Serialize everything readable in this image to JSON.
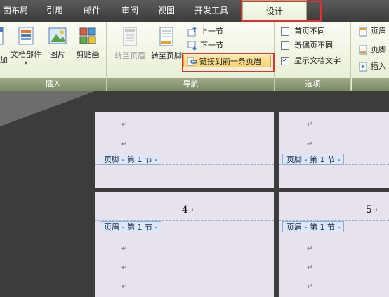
{
  "tabs": [
    {
      "label": "面布局"
    },
    {
      "label": "引用"
    },
    {
      "label": "邮件"
    },
    {
      "label": "审阅"
    },
    {
      "label": "视图"
    },
    {
      "label": "开发工具"
    },
    {
      "label": "设计"
    }
  ],
  "ribbon": {
    "insert_group": {
      "label": "插入",
      "buttons": [
        {
          "label": "加"
        },
        {
          "label": "文档部件"
        },
        {
          "label": "图片"
        },
        {
          "label": "剪贴画"
        }
      ]
    },
    "nav_group": {
      "label": "导航",
      "goto_header": "转至页眉",
      "goto_footer": "转至页脚",
      "prev_section": "上一节",
      "next_section": "下一节",
      "link_previous": "链接到前一条页眉"
    },
    "options_group": {
      "label": "选项",
      "first_page_diff": "首页不同",
      "odd_even_diff": "奇偶页不同",
      "show_doc_text": "显示文档文字"
    },
    "position_group": {
      "items": [
        "页眉",
        "页脚",
        "插入"
      ]
    }
  },
  "document": {
    "paragraph_mark": "↵",
    "footer_tag": "页脚 - 第 1 节 -",
    "header_tag": "页眉 - 第 1 节 -",
    "page_numbers": [
      "4",
      "5"
    ]
  }
}
